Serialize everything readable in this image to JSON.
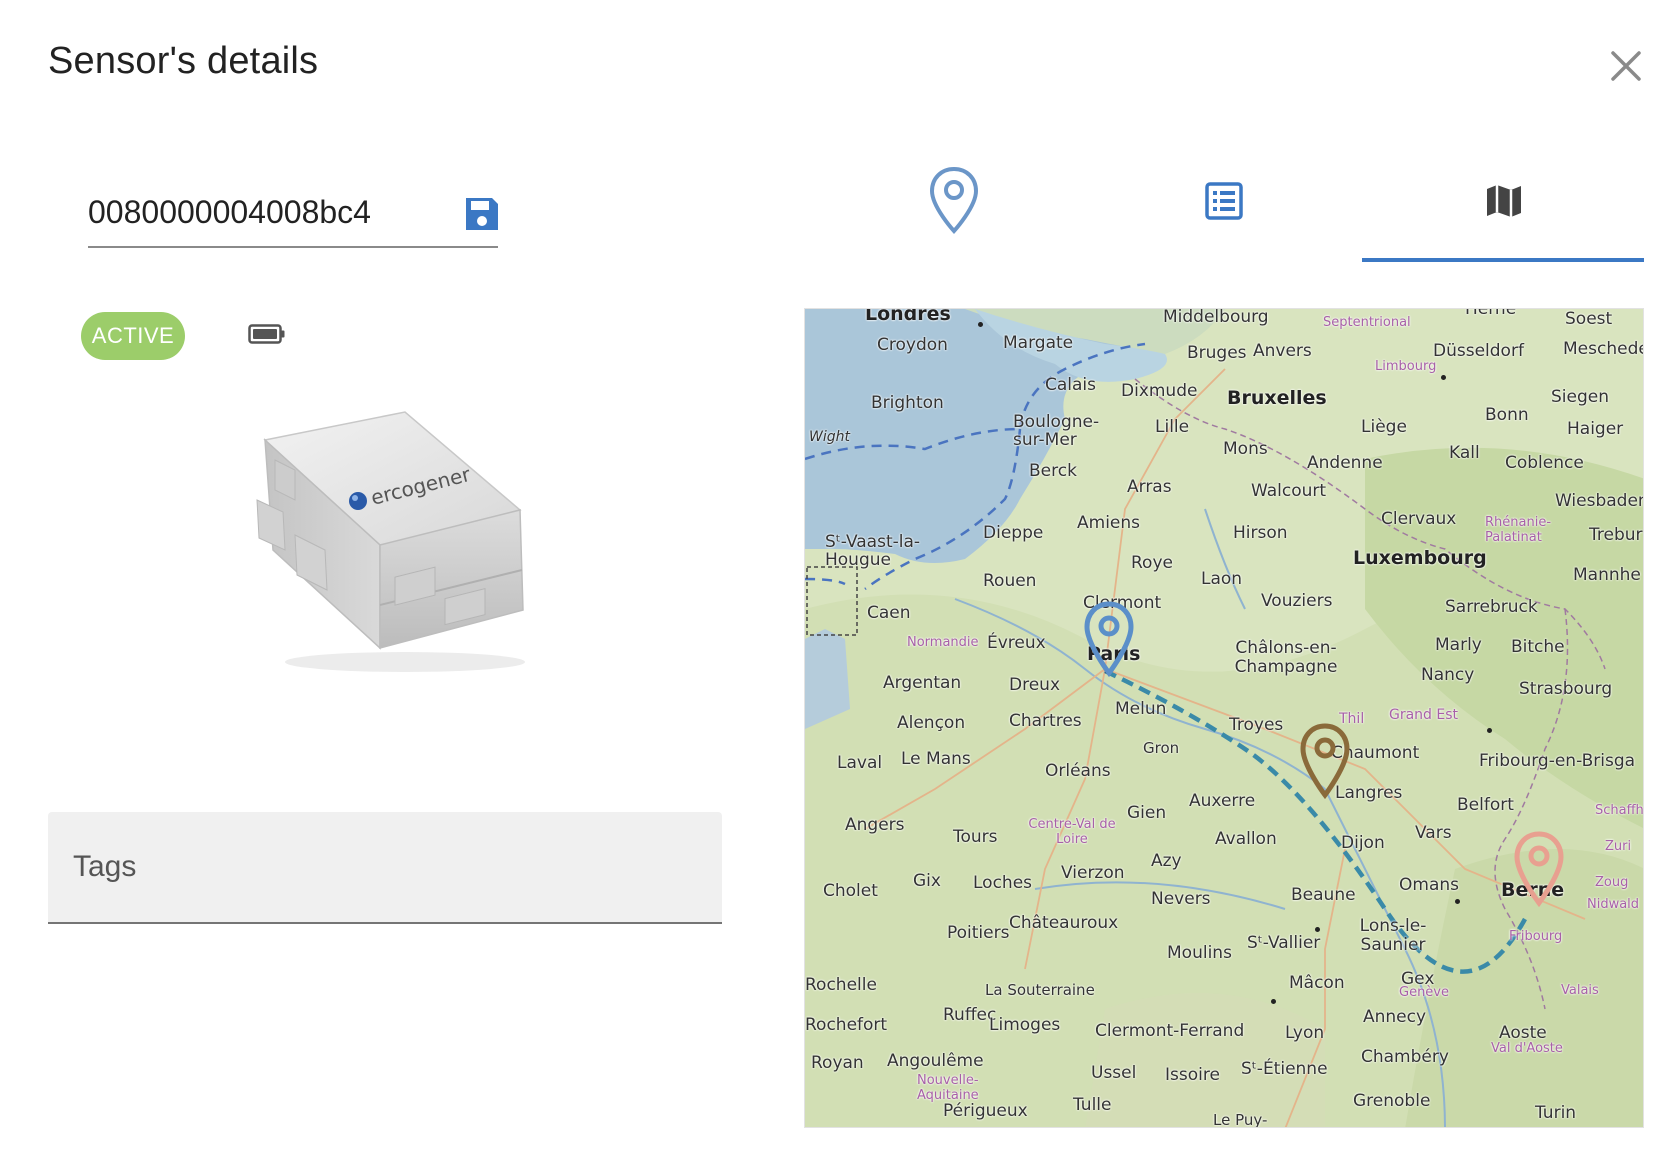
{
  "dialog": {
    "title": "Sensor's details"
  },
  "sensor": {
    "id_value": "0080000004008bc4",
    "status": "ACTIVE",
    "brand": "ercogener"
  },
  "tags": {
    "label": "Tags"
  },
  "tabs": [
    {
      "name": "location",
      "icon": "map-pin-icon",
      "active": false
    },
    {
      "name": "list",
      "icon": "list-icon",
      "active": false
    },
    {
      "name": "map",
      "icon": "map-icon",
      "active": true
    }
  ],
  "map": {
    "route_color": "#3a8aa8",
    "markers": [
      {
        "name": "Paris",
        "color": "#5b8fc9"
      },
      {
        "name": "Chaumont",
        "color": "#8a6a3a"
      },
      {
        "name": "Berne",
        "color": "#e8a090"
      }
    ],
    "labels": [
      "Londres",
      "Middelbourg",
      "Septentrional",
      "Herne",
      "Soest",
      "Croydon",
      "Margate",
      "Bruges",
      "Anvers",
      "Düsseldorf",
      "Meschede",
      "Limbourg",
      "Brighton",
      "Calais",
      "Dixmude",
      "Bruxelles",
      "Siegen",
      "Boulogne-sur-Mer",
      "Lille",
      "Liège",
      "Bonn",
      "Haiger",
      "Wight",
      "Mons",
      "Andenne",
      "Kall",
      "Coblence",
      "Berck",
      "Arras",
      "Walcourt",
      "Wiesbaden",
      "Sᵗ-Vaast-la-Hougue",
      "Dieppe",
      "Amiens",
      "Hirson",
      "Clervaux",
      "Rhénanie-Palatinat",
      "Trebur",
      "Luxembourg",
      "Roye",
      "Laon",
      "Rouen",
      "Mannhe",
      "Caen",
      "Clermont",
      "Vouziers",
      "Sarrebruck",
      "Normandie",
      "Évreux",
      "Paris",
      "Châlons-en-Champagne",
      "Marly",
      "Bitche",
      "Argentan",
      "Dreux",
      "Nancy",
      "Strasbourg",
      "Alençon",
      "Chartres",
      "Melun",
      "Troyes",
      "Thil",
      "Grand Est",
      "Laval",
      "Le Mans",
      "Orléans",
      "Gron",
      "Chaumont",
      "Fribourg-en-Brisga",
      "Langres",
      "Auxerre",
      "Belfort",
      "Schaffh",
      "Angers",
      "Tours",
      "Centre-Val de Loire",
      "Gien",
      "Avallon",
      "Dijon",
      "Vars",
      "Zuri",
      "Cholet",
      "Gix",
      "Loches",
      "Vierzon",
      "Azy",
      "Nevers",
      "Beaune",
      "Omans",
      "Berne",
      "Zoug",
      "Nidwald",
      "Châteauroux",
      "Poitiers",
      "Moulins",
      "Sᵗ-Vallier",
      "Lons-le-Saunier",
      "Fribourg",
      "Rochelle",
      "La Souterraine",
      "Mâcon",
      "Gex",
      "Genève",
      "Valais",
      "Ruffec",
      "Rochefort",
      "Limoges",
      "Clermont-Ferrand",
      "Lyon",
      "Annecy",
      "Aoste",
      "Val d'Aoste",
      "Royan",
      "Angoulême",
      "Nouvelle-Aquitaine",
      "Ussel",
      "Issoire",
      "Sᵗ-Étienne",
      "Chambéry",
      "Périgueux",
      "Tulle",
      "Grenoble",
      "Turin",
      "Le Puy-"
    ]
  }
}
